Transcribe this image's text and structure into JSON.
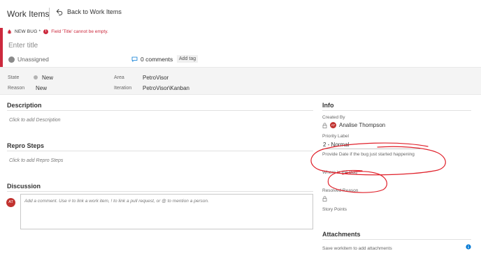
{
  "topbar": {
    "title": "Work Items",
    "back_label": "Back to Work Items"
  },
  "header": {
    "type_label": "NEW BUG *",
    "error_message": "Field 'Title' cannot be empty.",
    "title_placeholder": "Enter title",
    "assignee": "Unassigned",
    "comments_label": "0 comments",
    "add_tag_label": "Add tag",
    "accent_color": "#cc293d"
  },
  "fields": {
    "state_label": "State",
    "state_value": "New",
    "reason_label": "Reason",
    "reason_value": "New",
    "area_label": "Area",
    "area_value": "PetroVisor",
    "iteration_label": "Iteration",
    "iteration_value": "PetroVisor\\Kanban"
  },
  "description": {
    "title": "Description",
    "placeholder": "Click to add Description"
  },
  "repro": {
    "title": "Repro Steps",
    "placeholder": "Click to add Repro Steps"
  },
  "discussion": {
    "title": "Discussion",
    "avatar_initials": "AT",
    "placeholder": "Add a comment. Use # to link a work item, ! to link a pull request, or @ to mention a person."
  },
  "info": {
    "title": "Info",
    "created_by_label": "Created By",
    "created_by_initials": "AT",
    "created_by_value": "Analise Thompson",
    "priority_label": "Priority Label",
    "priority_value": "2 - Normal",
    "date_hint_label": "Provide Date if the bug just started happening",
    "where_label": "Where is the Bug",
    "resolved_label": "Resolved Reason",
    "story_points_label": "Story Points"
  },
  "attachments": {
    "title": "Attachments",
    "hint": "Save workitem to add attachments"
  },
  "annotation_color": "#e0202a"
}
